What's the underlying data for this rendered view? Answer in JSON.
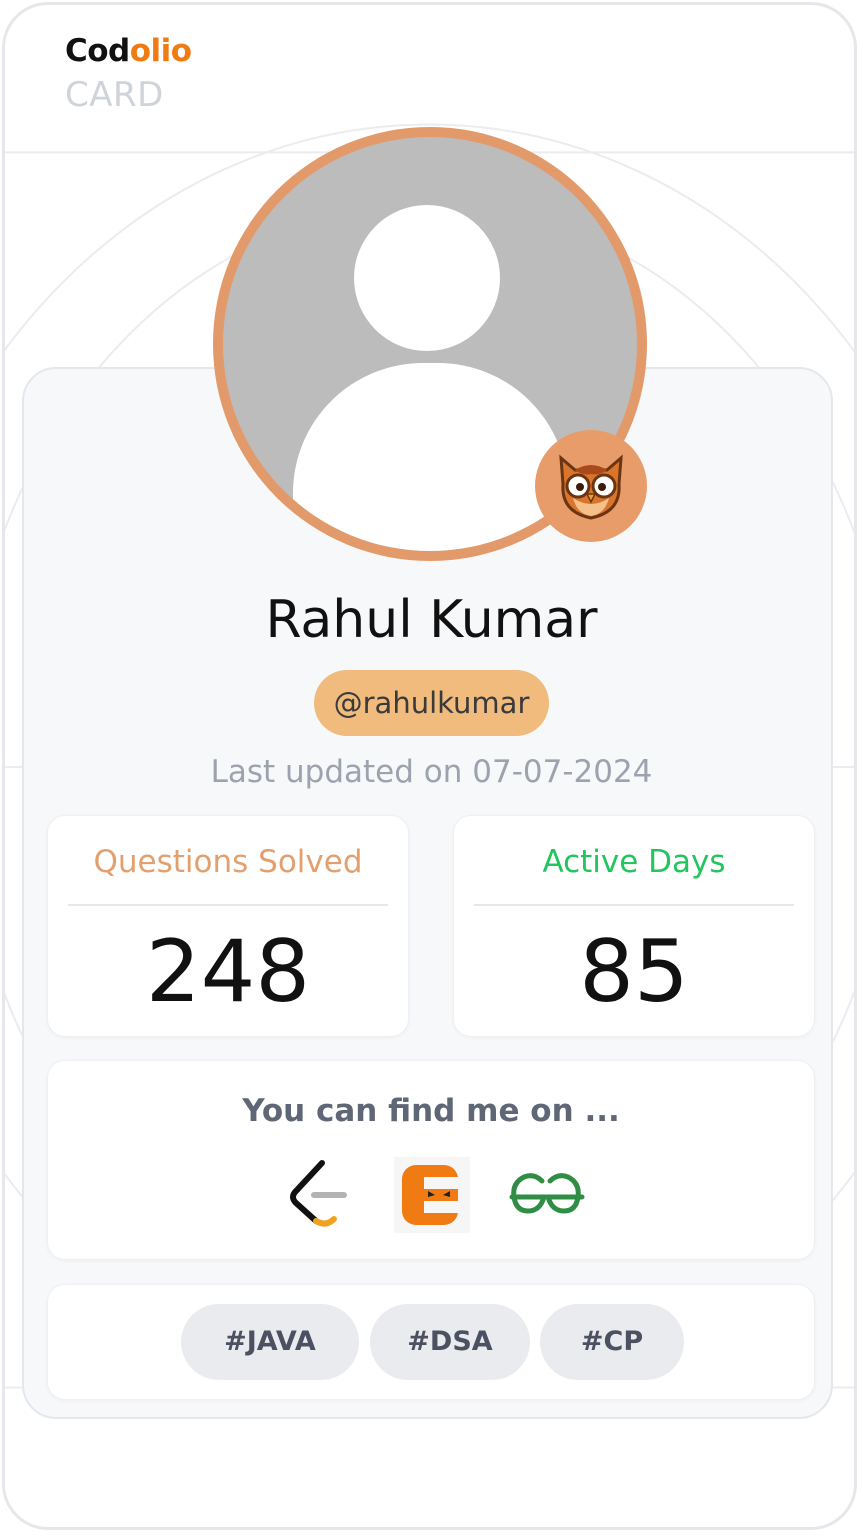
{
  "brand": {
    "name_part1": "Cod",
    "name_part2": "olio",
    "subtitle": "CARD"
  },
  "profile": {
    "name": "Rahul Kumar",
    "handle": "@rahulkumar",
    "last_updated": "Last updated on 07-07-2024",
    "avatar_icon": "default-user-avatar",
    "badge_icon": "owl-icon"
  },
  "stats": [
    {
      "label": "Questions Solved",
      "value": "248",
      "color": "#e3a06f"
    },
    {
      "label": "Active Days",
      "value": "85",
      "color": "#22c55e"
    }
  ],
  "find_me": {
    "title": "You can find me on ...",
    "platforms": [
      {
        "icon": "leetcode-icon"
      },
      {
        "icon": "codingninjas-icon"
      },
      {
        "icon": "geeksforgeeks-icon"
      }
    ]
  },
  "tags": [
    "#JAVA",
    "#DSA",
    "#CP"
  ],
  "colors": {
    "accent": "#f07b12",
    "ring": "#e29a6b",
    "handle_bg": "#f0bb7c"
  }
}
